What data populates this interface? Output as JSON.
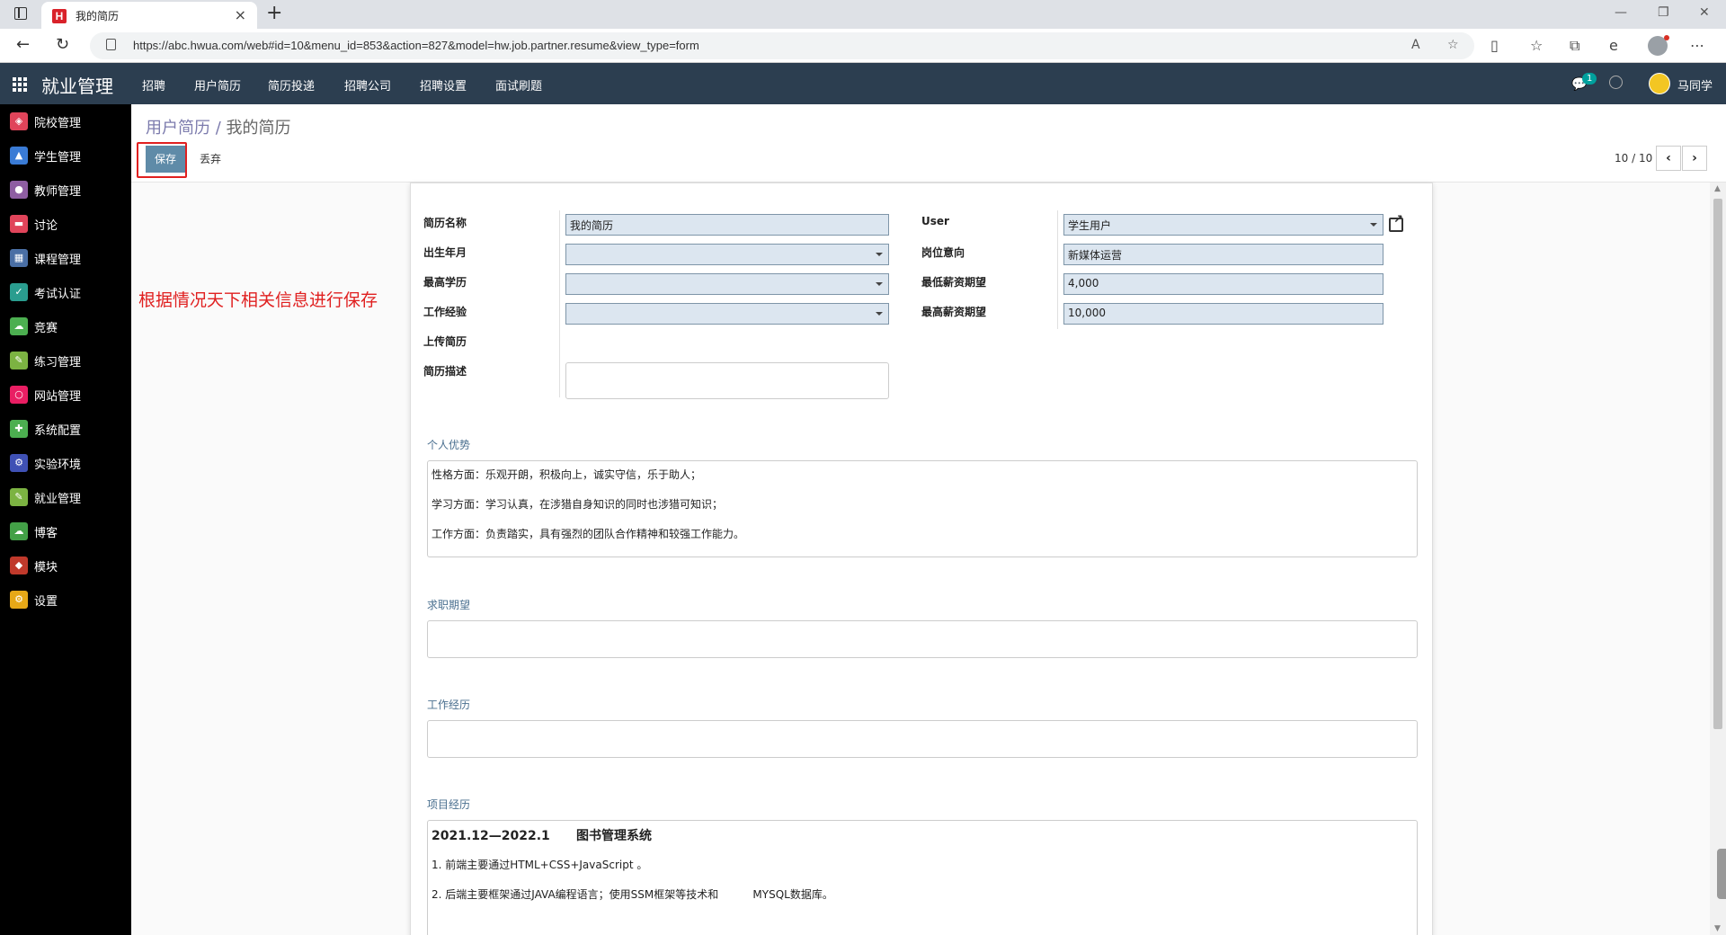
{
  "browser": {
    "tab_title": "我的简历",
    "favicon_letter": "H",
    "url": "https://abc.hwua.com/web#id=10&menu_id=853&action=827&model=hw.job.partner.resume&view_type=form"
  },
  "app": {
    "brand": "就业管理",
    "menu": [
      "招聘",
      "用户简历",
      "简历投递",
      "招聘公司",
      "招聘设置",
      "面试刷题"
    ],
    "chat_badge": "1",
    "user_name": "马同学"
  },
  "sidebar": {
    "items": [
      {
        "label": "院校管理",
        "color": "#e0445a"
      },
      {
        "label": "学生管理",
        "color": "#3a7bd5"
      },
      {
        "label": "教师管理",
        "color": "#8e5ea2"
      },
      {
        "label": "讨论",
        "color": "#e0445a"
      },
      {
        "label": "课程管理",
        "color": "#4a6fa5"
      },
      {
        "label": "考试认证",
        "color": "#2a9d8f"
      },
      {
        "label": "竞赛",
        "color": "#4caf50"
      },
      {
        "label": "练习管理",
        "color": "#7cb342"
      },
      {
        "label": "网站管理",
        "color": "#e91e63"
      },
      {
        "label": "系统配置",
        "color": "#4caf50"
      },
      {
        "label": "实验环境",
        "color": "#3f51b5"
      },
      {
        "label": "就业管理",
        "color": "#7cb342"
      },
      {
        "label": "博客",
        "color": "#43a047"
      },
      {
        "label": "模块",
        "color": "#c0392b"
      },
      {
        "label": "设置",
        "color": "#e6a817"
      }
    ]
  },
  "breadcrumb": {
    "parent": "用户简历",
    "separator": " / ",
    "current": "我的简历"
  },
  "buttons": {
    "save": "保存",
    "discard": "丢弃"
  },
  "pager": {
    "text": "10 / 10"
  },
  "annotation": "根据情况天下相关信息进行保存",
  "form": {
    "left": [
      {
        "label": "简历名称",
        "value": "我的简历",
        "type": "text"
      },
      {
        "label": "出生年月",
        "value": "",
        "type": "select"
      },
      {
        "label": "最高学历",
        "value": "",
        "type": "select"
      },
      {
        "label": "工作经验",
        "value": "",
        "type": "select"
      },
      {
        "label": "上传简历",
        "value": "",
        "type": "none"
      },
      {
        "label": "简历描述",
        "value": "",
        "type": "textarea"
      }
    ],
    "right": [
      {
        "label": "User",
        "value": "学生用户",
        "type": "select"
      },
      {
        "label": "岗位意向",
        "value": "新媒体运营",
        "type": "text"
      },
      {
        "label": "最低薪资期望",
        "value": "4,000",
        "type": "text"
      },
      {
        "label": "最高薪资期望",
        "value": "10,000",
        "type": "text"
      }
    ]
  },
  "sections": {
    "advantages": {
      "title": "个人优势",
      "lines": [
        "性格方面：乐观开朗，积极向上，诚实守信，乐于助人；",
        "学习方面：学习认真，在涉猎自身知识的同时也涉猎可知识；",
        "工作方面：负责踏实，具有强烈的团队合作精神和较强工作能力。"
      ]
    },
    "expectation": {
      "title": "求职期望"
    },
    "work": {
      "title": "工作经历"
    },
    "project": {
      "title": "项目经历",
      "period": "2021.12—2022.1",
      "name": "图书管理系统",
      "lines": [
        "1. 前端主要通过HTML+CSS+JavaScript 。",
        "2. 后端主要框架通过JAVA编程语言；使用SSM框架等技术和          MYSQL数据库。"
      ]
    }
  }
}
